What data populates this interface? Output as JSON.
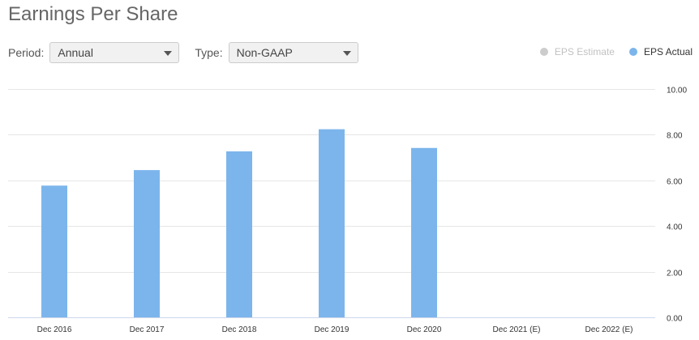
{
  "title": "Earnings Per Share",
  "controls": {
    "period_label": "Period:",
    "period_value": "Annual",
    "type_label": "Type:",
    "type_value": "Non-GAAP"
  },
  "legend": {
    "estimate": {
      "label": "EPS Estimate",
      "color": "#cccccc"
    },
    "actual": {
      "label": "EPS Actual",
      "color": "#7cb5ec"
    }
  },
  "chart_data": {
    "type": "bar",
    "categories": [
      "Dec 2016",
      "Dec 2017",
      "Dec 2018",
      "Dec 2019",
      "Dec 2020",
      "Dec 2021 (E)",
      "Dec 2022 (E)"
    ],
    "series": [
      {
        "name": "EPS Actual",
        "color": "#7cb5ec",
        "values": [
          5.77,
          6.45,
          7.27,
          8.24,
          7.42,
          null,
          null
        ]
      },
      {
        "name": "EPS Estimate",
        "color": "#cccccc",
        "values": [
          null,
          null,
          null,
          null,
          null,
          null,
          null
        ]
      }
    ],
    "ylim": [
      0,
      10
    ],
    "yticks": [
      "0.00",
      "2.00",
      "4.00",
      "6.00",
      "8.00",
      "10.00"
    ],
    "grid": true,
    "legend_position": "top-right"
  }
}
